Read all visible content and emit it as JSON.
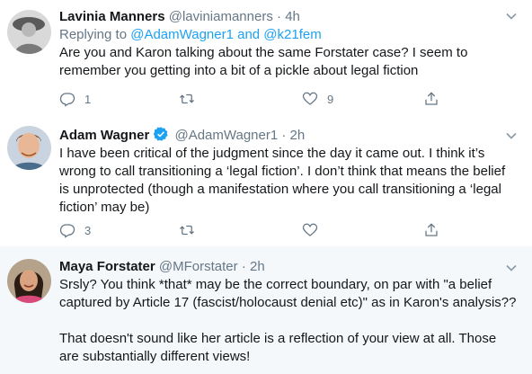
{
  "tweets": [
    {
      "name": "Lavinia Manners",
      "handle": "@laviniamanners",
      "time": "4h",
      "replying_prefix": "Replying to ",
      "replying_to": "@AdamWagner1 and @k21fem",
      "text": "Are you and Karon talking about the same Forstater case? I seem to remember you getting into a bit of a pickle about legal fiction",
      "replies": "1",
      "retweets": "",
      "likes": "9"
    },
    {
      "name": "Adam Wagner",
      "handle": "@AdamWagner1",
      "time": "2h",
      "verified": true,
      "text": "I have been critical of the judgment since the day it came out. I think it’s wrong to call transitioning a ‘legal fiction’. I don’t think that means the belief is unprotected (though a manifestation where you call transitioning a ‘legal fiction’ may be)",
      "replies": "3",
      "retweets": "",
      "likes": ""
    },
    {
      "name": "Maya Forstater",
      "handle": "@MForstater",
      "time": "2h",
      "text": "Srsly? You think *that* may be the correct boundary, on par with \"a belief captured by Article 17 (fascist/holocaust denial etc)\" as in Karon's analysis??\n\nThat doesn't sound like her article is a reflection of your view at all. Those are substantially different views!"
    }
  ],
  "separator": "·",
  "colors": {
    "accent": "#1da1f2",
    "muted": "#657786",
    "text": "#14171a",
    "highlight_bg": "#f5f8fa"
  }
}
